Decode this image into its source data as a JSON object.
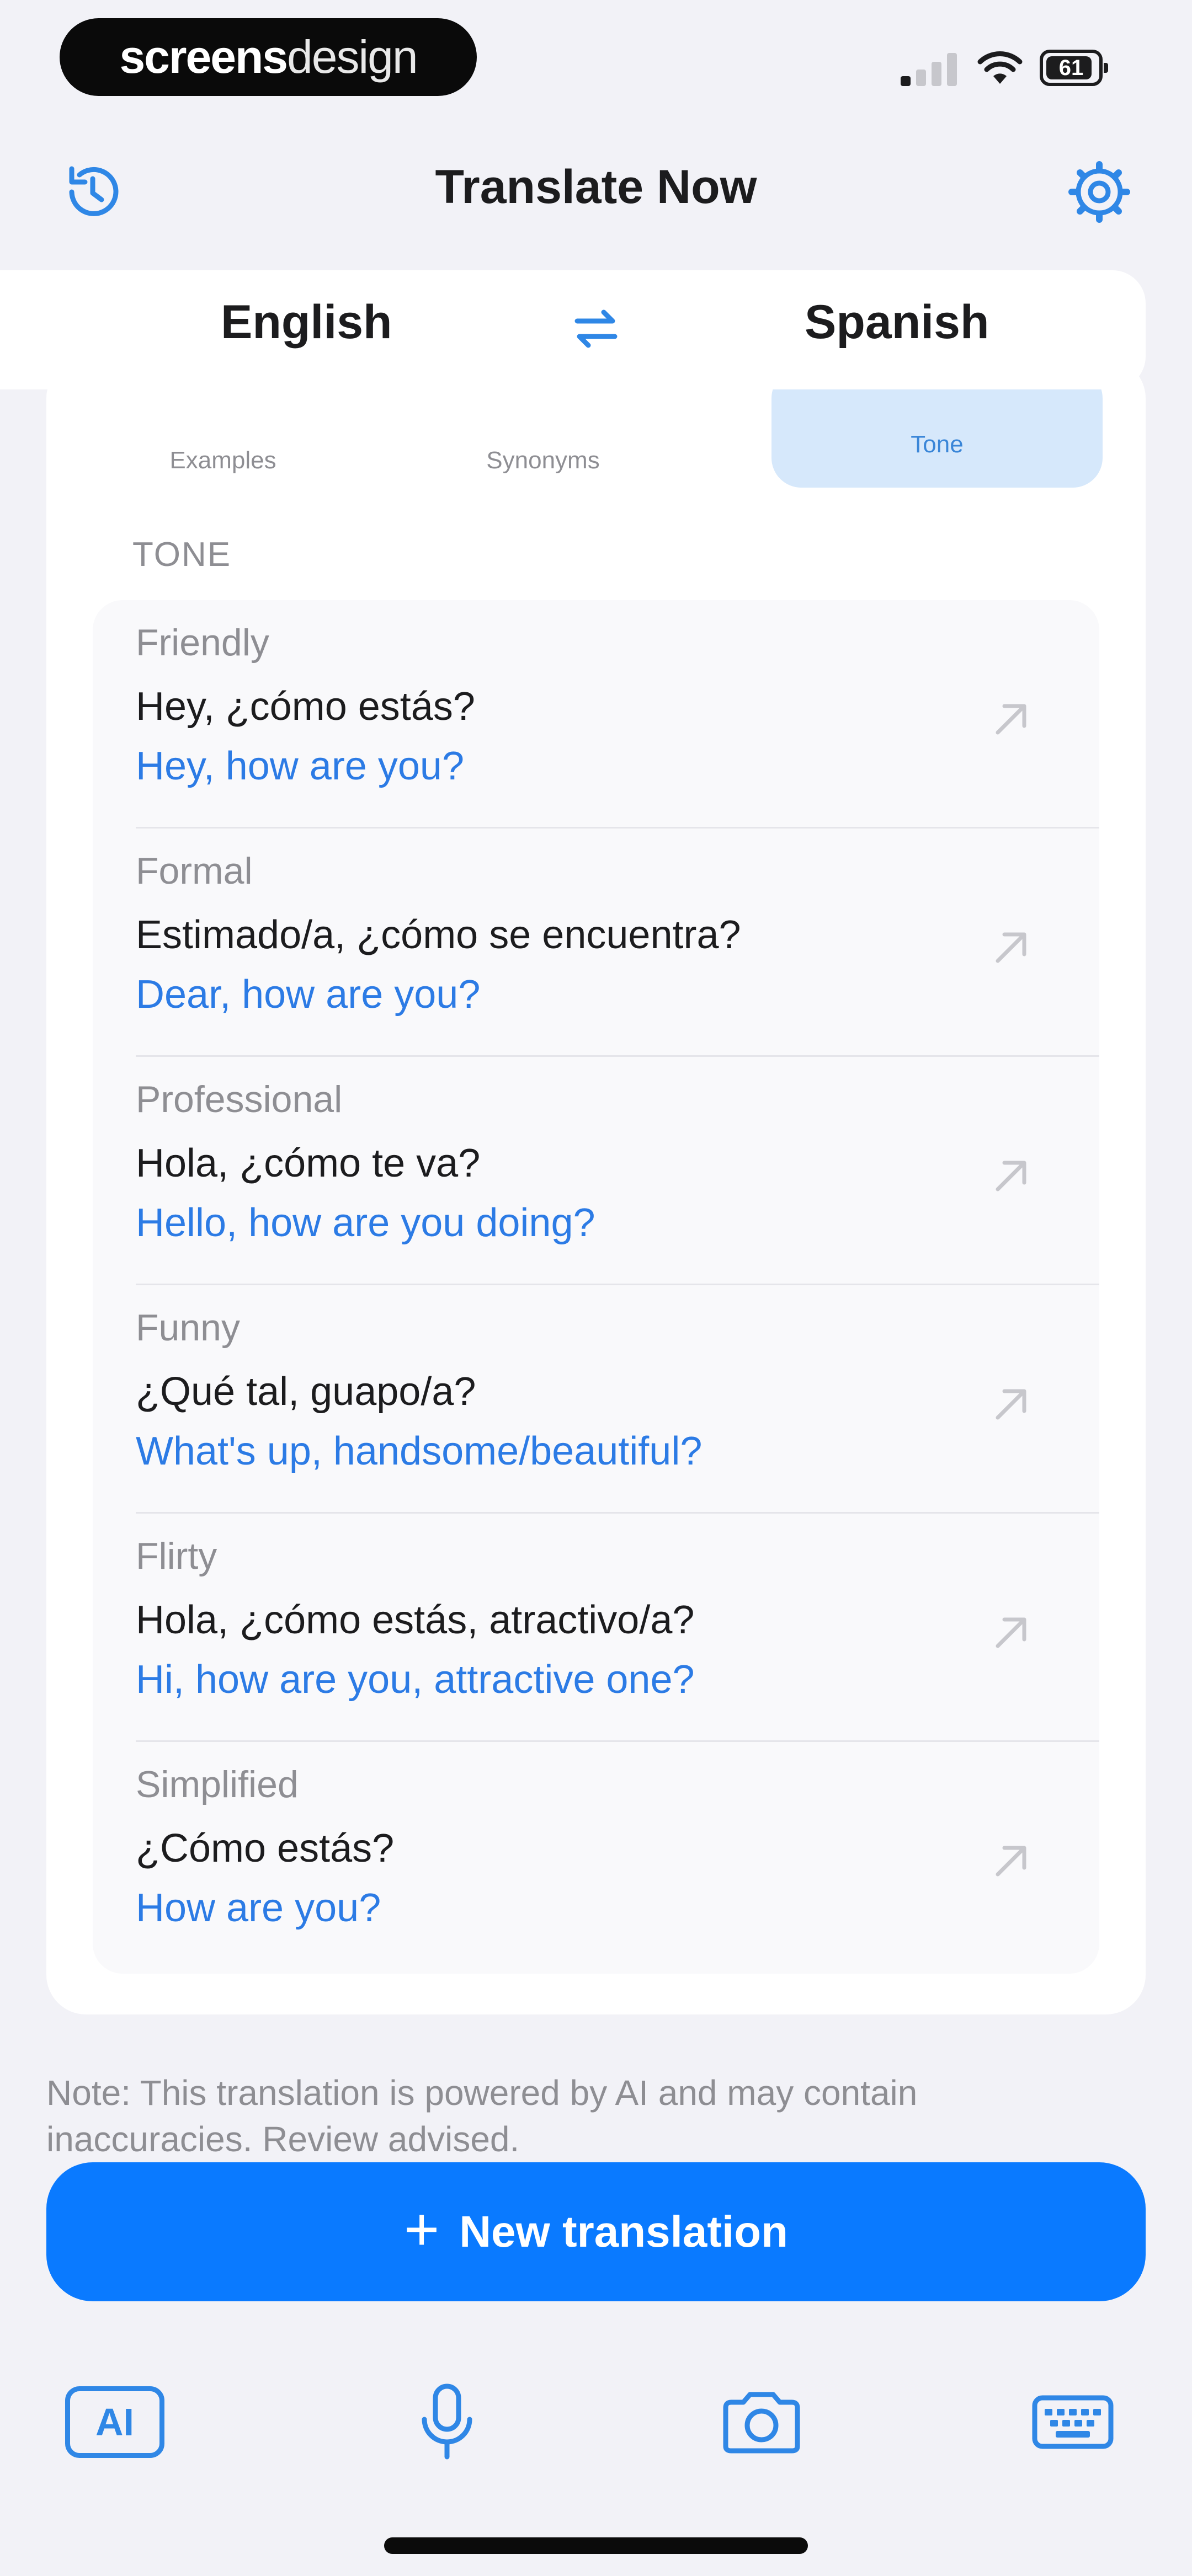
{
  "status_bar": {
    "brand_part1": "screens",
    "brand_part2": "design",
    "battery": "61"
  },
  "nav": {
    "title": "Translate Now",
    "history_icon": "history-icon",
    "settings_icon": "gear-icon"
  },
  "languages": {
    "source": "English",
    "target": "Spanish",
    "swap_icon": "swap-arrows-icon"
  },
  "tabs": [
    {
      "label": "Examples"
    },
    {
      "label": "Synonyms"
    },
    {
      "label": "Tone",
      "active": true
    }
  ],
  "section_label": "TONE",
  "tones": [
    {
      "label": "Friendly",
      "source": "Hey, ¿cómo estás?",
      "translation": "Hey, how are you?"
    },
    {
      "label": "Formal",
      "source": "Estimado/a, ¿cómo se encuentra?",
      "translation": "Dear, how are you?"
    },
    {
      "label": "Professional",
      "source": "Hola, ¿cómo te va?",
      "translation": "Hello, how are you doing?"
    },
    {
      "label": "Funny",
      "source": "¿Qué tal, guapo/a?",
      "translation": "What's up, handsome/beautiful?"
    },
    {
      "label": "Flirty",
      "source": "Hola, ¿cómo estás, atractivo/a?",
      "translation": "Hi, how are you, attractive one?"
    },
    {
      "label": "Simplified",
      "source": "¿Cómo estás?",
      "translation": "How are you?"
    }
  ],
  "note": "Note: This translation is powered by AI and may contain inaccuracies. Review advised.",
  "new_translation_button": "New translation",
  "bottom_bar": {
    "ai_label": "AI"
  },
  "colors": {
    "accent": "#0a7aff",
    "translation_text": "#2c7be5",
    "active_tab_bg": "#d6e8fb",
    "background": "#f2f2f7"
  }
}
